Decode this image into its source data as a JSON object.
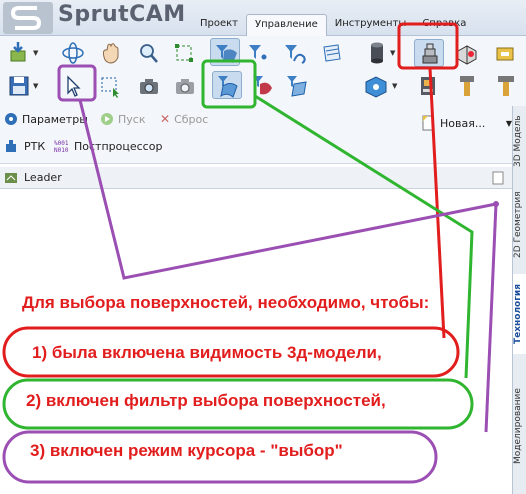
{
  "app": {
    "brand": "SprutCAM"
  },
  "ribbon_tabs": [
    {
      "label": "Проект"
    },
    {
      "label": "Управление"
    },
    {
      "label": "Инструменты"
    },
    {
      "label": "Справка"
    }
  ],
  "toolbar": {
    "parameters_label": "Параметры",
    "start_label": "Пуск",
    "reset_label": "Сброс",
    "new_label": "Новая...",
    "rtk_label": "РТК",
    "postprocessor_label": "Постпроцессор"
  },
  "panel": {
    "leader_label": "Leader"
  },
  "side_tabs": [
    {
      "label": "3D Модель"
    },
    {
      "label": "2D Геометрия"
    },
    {
      "label": "Технология"
    },
    {
      "label": "Моделирование"
    }
  ],
  "instructions": {
    "heading": "Для выбора поверхностей, необходимо, чтобы:",
    "item1": "1) была включена видимость 3д-модели,",
    "item2": "2) включен фильтр выбора поверхностей,",
    "item3": "3) включен режим курсора - \"выбор\""
  },
  "colors": {
    "red": "#e21d1d",
    "green": "#2fb52f",
    "purple": "#9b4fb3"
  }
}
